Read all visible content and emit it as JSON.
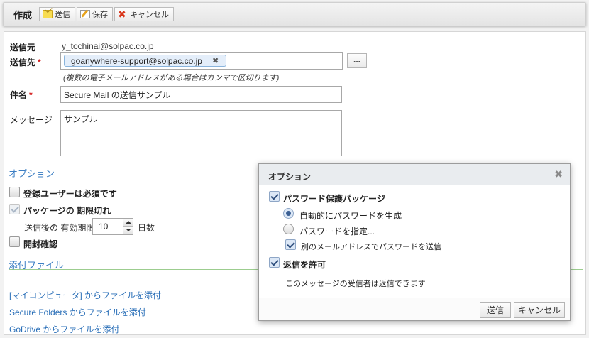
{
  "toolbar": {
    "title": "作成",
    "send_label": "送信",
    "save_label": "保存",
    "cancel_label": "キャンセル"
  },
  "form": {
    "from_label": "送信元",
    "from_value": "y_tochinai@solpac.co.jp",
    "to_label": "送信先",
    "required_mark": "*",
    "to_recipient": "goanywhere-support@solpac.co.jp",
    "chip_remove": "✖",
    "browse_label": "...",
    "to_hint": "(複数の電子メールアドレスがある場合はカンマで区切ります)",
    "subject_label": "件名",
    "subject_value": "Secure Mail の送信サンプル",
    "message_label": "メッセージ",
    "message_value": "サンプル"
  },
  "options_section": {
    "heading": "オプション",
    "registered_user_required": "登録ユーザーは必須です",
    "package_expiry": "パッケージの 期限切れ",
    "expiry_prefix": "送信後の 有効期限",
    "expiry_value": "10",
    "expiry_unit": "日数",
    "read_receipt": "開封確認"
  },
  "attachments_section": {
    "heading": "添付ファイル",
    "links": [
      "[マイコンピュータ] からファイルを添付",
      "Secure Folders からファイルを添付",
      "GoDrive からファイルを添付"
    ]
  },
  "dialog": {
    "title": "オプション",
    "close": "✖",
    "password_package": "パスワード保護パッケージ",
    "auto_generate": "自動的にパスワードを生成",
    "specify_password": "パスワードを指定...",
    "send_password_separately": "別のメールアドレスでパスワードを送信",
    "allow_reply": "返信を許可",
    "reply_note": "このメッセージの受信者は返信できます",
    "ok_label": "送信",
    "cancel_label": "キャンセル"
  }
}
